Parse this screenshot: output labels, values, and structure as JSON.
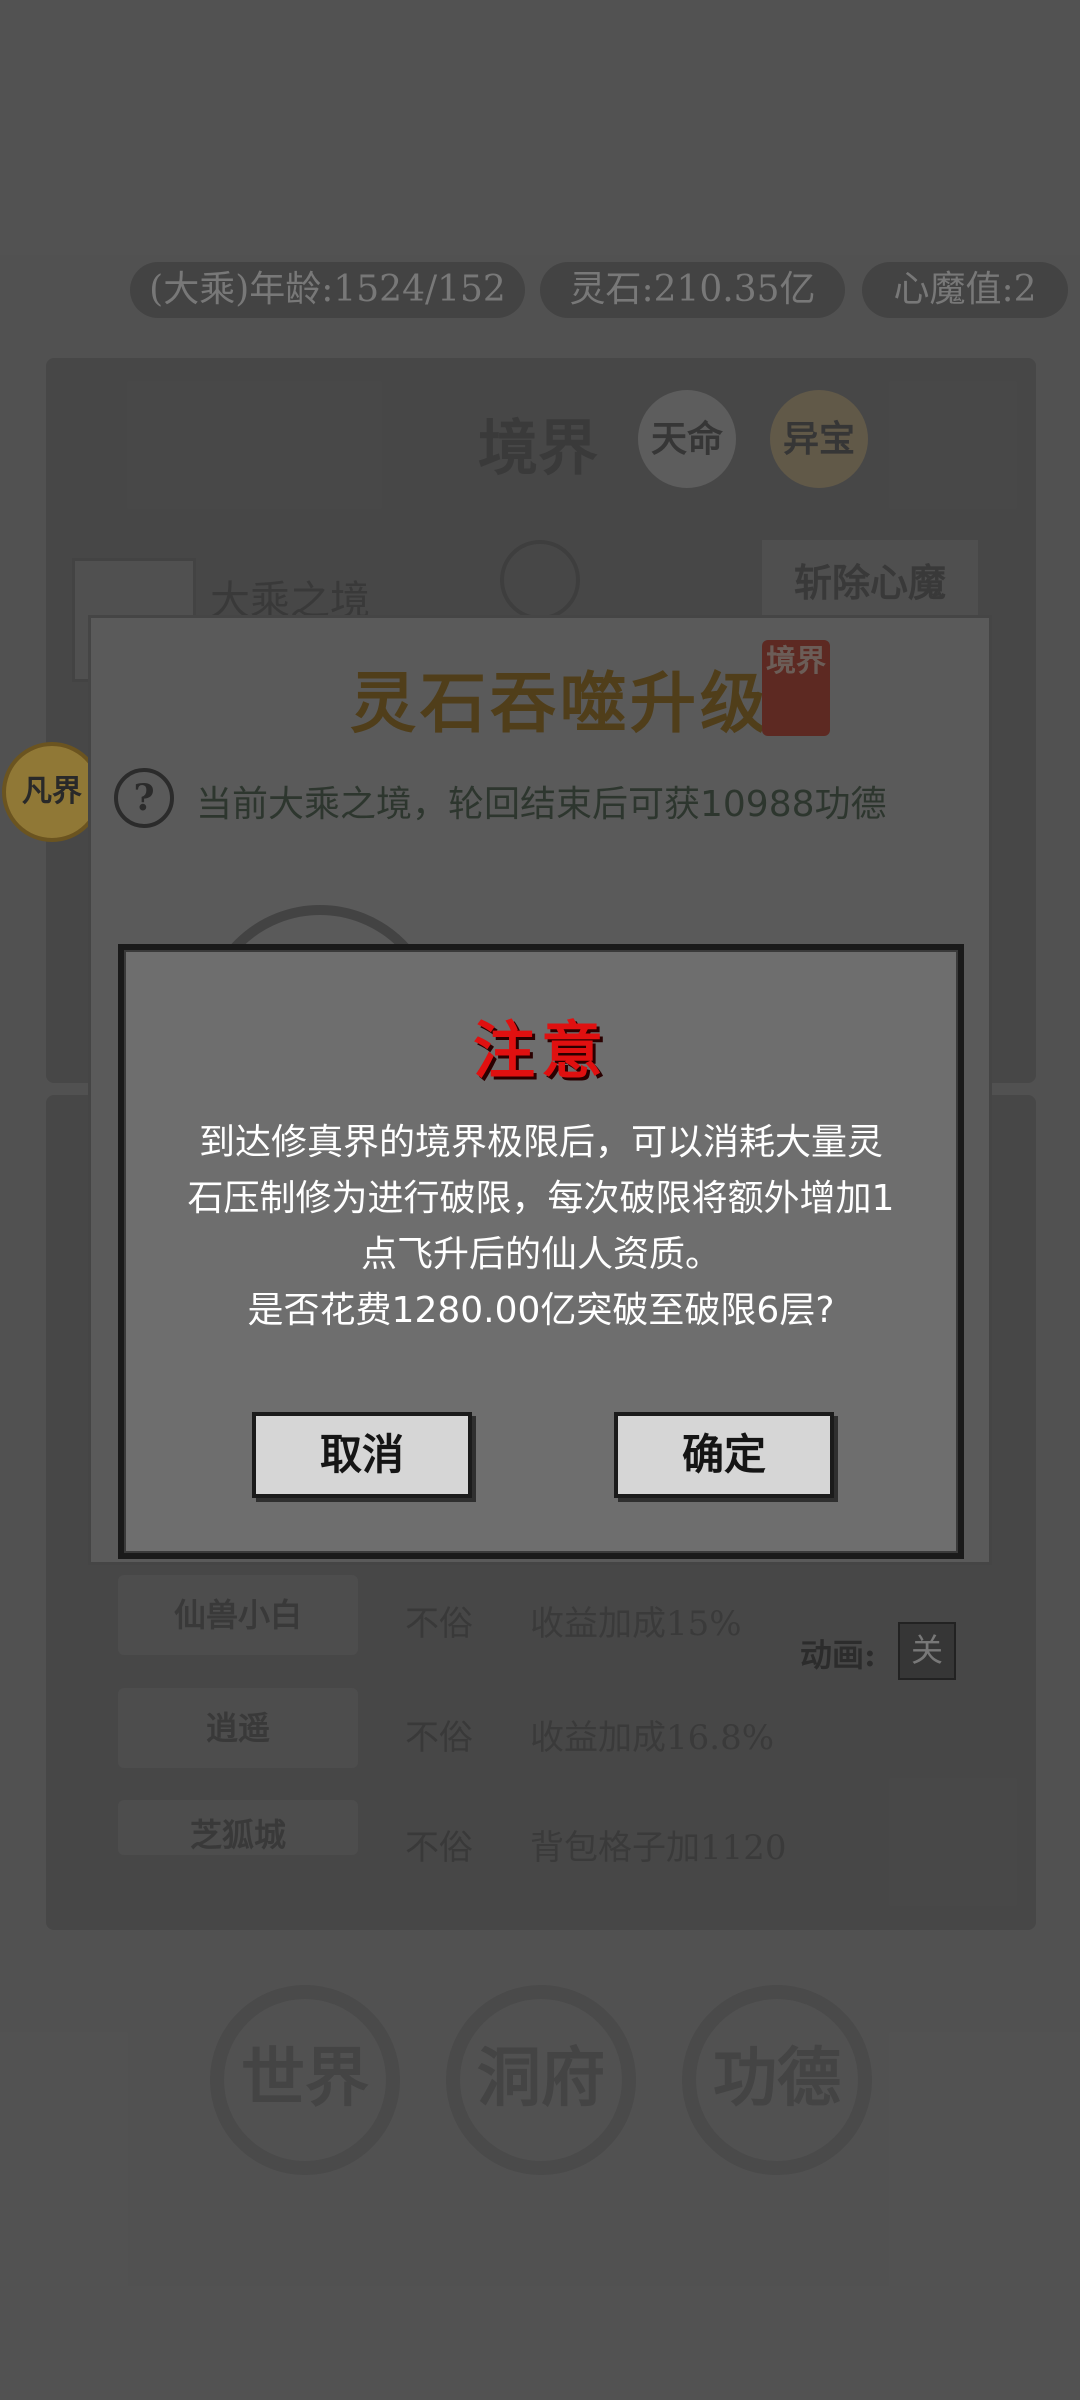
{
  "status_bar": {
    "age": "(大乘)年龄:1524/152",
    "spirit_stone": "灵石:210.35亿",
    "demon_value": "心魔值:2"
  },
  "main_panel": {
    "title": "境界",
    "tab_fate": "天命",
    "tab_treasure": "异宝",
    "realm_name": "大乘之境",
    "slay_demon_button": "斩除心魔"
  },
  "side_badge": {
    "label": "凡界"
  },
  "upgrade_panel": {
    "title": "灵石吞噬升级",
    "seal": "境界",
    "help_icon": "?",
    "info_text": "当前大乘之境，轮回结束后可获10988功德"
  },
  "dialog": {
    "title": "注意",
    "body_lines": [
      "到达修真界的境界极限后，可以消耗大量灵",
      "石压制修为进行破限，每次破限将额外增加1",
      "点飞升后的仙人资质。",
      "是否花费1280.00亿突破至破限6层?"
    ],
    "cancel_label": "取消",
    "confirm_label": "确定"
  },
  "lower_list": {
    "animation_label": "动画:",
    "animation_toggle": "关",
    "rows": [
      {
        "tag": "仙兽小白",
        "status": "不俗",
        "effect": "收益加成15%"
      },
      {
        "tag": "逍遥",
        "status": "不俗",
        "effect": "收益加成16.8%"
      },
      {
        "tag": "芝狐城",
        "status": "不俗",
        "effect": "背包格子加1120"
      }
    ]
  },
  "bottom_nav": {
    "world": "世界",
    "cave": "洞府",
    "merit": "功德"
  },
  "colors": {
    "dialog_title": "#e01010",
    "accent_gold": "#a88a3a"
  }
}
